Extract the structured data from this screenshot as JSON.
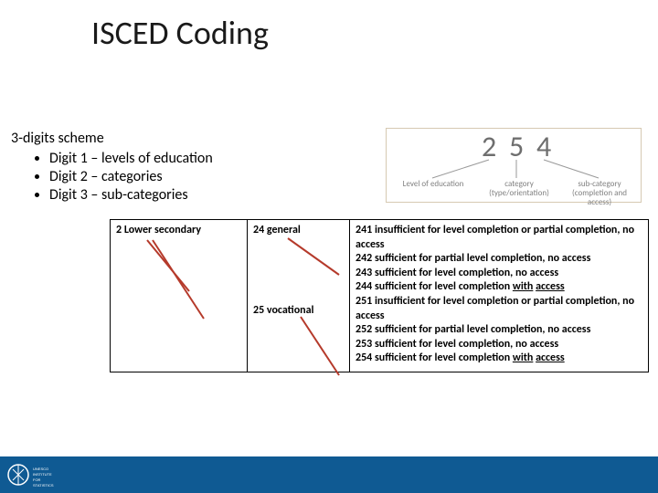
{
  "title": "ISCED Coding",
  "scheme": {
    "heading": "3-digits scheme",
    "items": [
      "Digit 1 – levels of education",
      "Digit 2 – categories",
      "Digit 3 – sub-categories"
    ]
  },
  "diagram": {
    "digits": [
      "2",
      "5",
      "4"
    ],
    "labels": {
      "level": "Level of education",
      "category_top": "category",
      "category_sub": "(type/orientation)",
      "sub_top": "sub-category",
      "sub_sub": "(completion and access)"
    }
  },
  "table": {
    "col1": {
      "code": "2",
      "label": "Lower secondary"
    },
    "col2": {
      "row1": {
        "code": "24",
        "label": "general"
      },
      "row2": {
        "code": "25",
        "label": "vocational"
      }
    },
    "col3": [
      {
        "code": "241",
        "text": "insufficient for level completion or partial completion, no access"
      },
      {
        "code": "242",
        "text": "sufficient for partial level completion, no access"
      },
      {
        "code": "243",
        "text": "sufficient for level completion, no access"
      },
      {
        "code": "244",
        "text_prefix": "sufficient for level completion ",
        "u1": "with",
        "mid": " ",
        "u2": "access"
      },
      {
        "code": "251",
        "text": "insufficient for level completion or partial completion, no access"
      },
      {
        "code": "252",
        "text": "sufficient for partial level completion, no access"
      },
      {
        "code": "253",
        "text": "sufficient for level completion, no access"
      },
      {
        "code": "254",
        "text_prefix": "sufficient for level completion ",
        "u1": "with",
        "mid": " ",
        "u2": "access"
      }
    ]
  },
  "footer": {
    "org": "UNESCO INSTITUTE FOR STATISTICS"
  }
}
